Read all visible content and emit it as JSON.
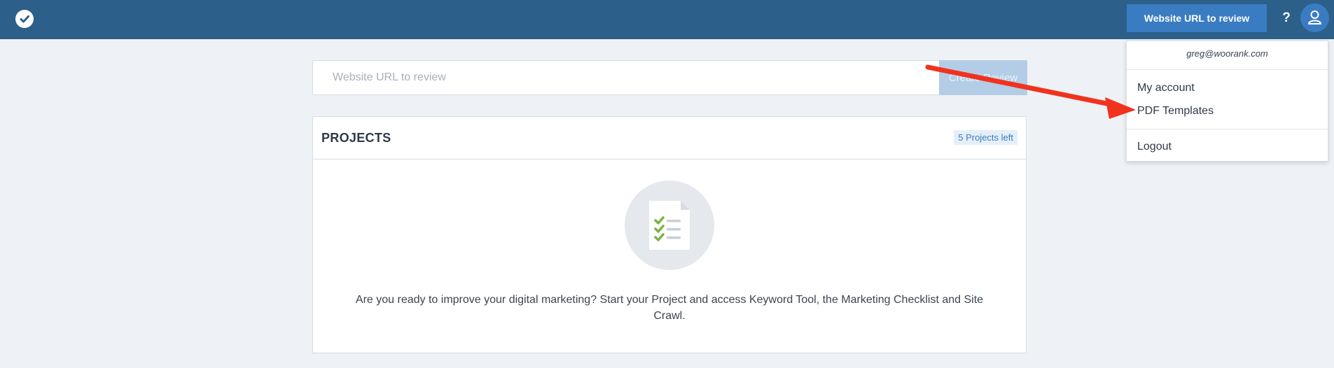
{
  "header": {
    "logo_icon": "check-badge-icon",
    "cta_label": "Website URL to review",
    "help_label": "?",
    "user_icon": "user-icon"
  },
  "url_bar": {
    "placeholder": "Website URL to review",
    "value": "",
    "create_label": "Create Review"
  },
  "projects": {
    "title": "PROJECTS",
    "badge": "5 Projects left",
    "empty_icon": "checklist-document-icon",
    "empty_text": "Are you ready to improve your digital marketing? Start your Project and access Keyword Tool, the Marketing Checklist and Site Crawl."
  },
  "user_menu": {
    "email": "greg@woorank.com",
    "items": [
      {
        "label": "My account"
      },
      {
        "label": "PDF Templates"
      },
      {
        "label": "Logout"
      }
    ]
  },
  "annotation": {
    "type": "arrow",
    "color": "#f0321e",
    "points_to": "PDF Templates"
  },
  "colors": {
    "topbar": "#2c5f8a",
    "accent": "#3a7cc1",
    "background": "#eef1f5",
    "check_green": "#7cb342"
  }
}
